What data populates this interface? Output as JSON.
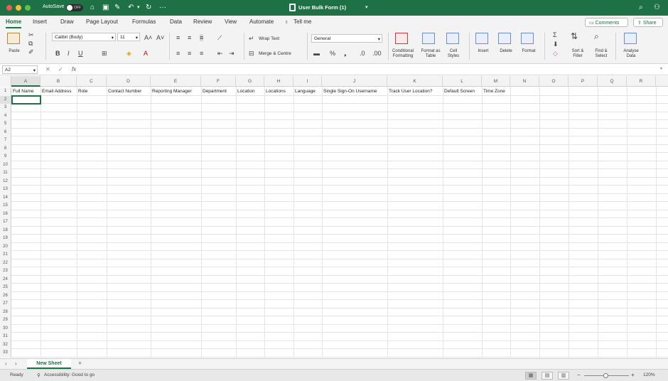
{
  "titlebar": {
    "autosave_label": "AutoSave",
    "autosave_state": "OFF",
    "doc_title": "User Bulk Form (1)",
    "icons": [
      "home-icon",
      "save-icon",
      "edit-icon",
      "undo-icon",
      "redo-icon",
      "more-icon",
      "search-icon",
      "share-people-icon"
    ]
  },
  "menu": {
    "tabs": [
      "Home",
      "Insert",
      "Draw",
      "Page Layout",
      "Formulas",
      "Data",
      "Review",
      "View",
      "Automate"
    ],
    "tell_me": "Tell me",
    "comments": "Comments",
    "share": "Share"
  },
  "ribbon": {
    "paste_label": "Paste",
    "font_name": "Calibri (Body)",
    "font_size": "11",
    "bold": "B",
    "italic": "I",
    "underline": "U",
    "wrap_text": "Wrap Text",
    "merge_centre": "Merge & Centre",
    "number_format": "General",
    "conditional_formatting": "Conditional Formatting",
    "format_as_table": "Format as Table",
    "cell_styles": "Cell Styles",
    "insert": "Insert",
    "delete": "Delete",
    "format": "Format",
    "sort_filter": "Sort & Filter",
    "find_select": "Find & Select",
    "analyse_data": "Analyse Data"
  },
  "formula_bar": {
    "name_box": "A2",
    "fx": "fx"
  },
  "grid": {
    "columns": [
      "A",
      "B",
      "C",
      "D",
      "E",
      "F",
      "G",
      "H",
      "I",
      "J",
      "K",
      "L",
      "M",
      "N",
      "O",
      "P",
      "Q",
      "R"
    ],
    "selected_column": "A",
    "selected_row": "2",
    "headers_row1": [
      "Full Name",
      "Email Address",
      "Role",
      "Contact Number",
      "Reporting Manager",
      "Department",
      "Location",
      "Locations",
      "Language",
      "Single Sign-On Username",
      "Track User Location?",
      "Default Screen",
      "Time Zone"
    ],
    "row_count": 33
  },
  "sheet": {
    "tab_name": "New Sheet",
    "add": "+"
  },
  "status": {
    "ready": "Ready",
    "accessibility": "Accessibility: Good to go",
    "zoom": "120%",
    "zoom_minus": "−",
    "zoom_plus": "+"
  }
}
